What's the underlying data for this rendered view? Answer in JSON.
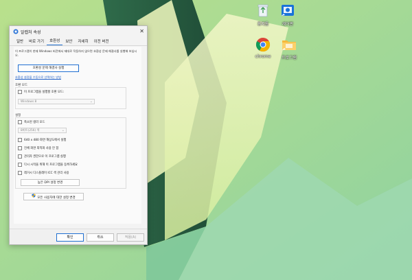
{
  "desktop": {
    "icons": [
      {
        "name": "recycle-bin",
        "label": "휴지통"
      },
      {
        "name": "control-panel",
        "label": "제어판"
      },
      {
        "name": "chrome",
        "label": "chrome"
      },
      {
        "name": "program-folder",
        "label": "프로그램"
      }
    ]
  },
  "dialog": {
    "title": "알캡처 속성",
    "tabs": [
      "일반",
      "바로 가기",
      "호환성",
      "보안",
      "자세히",
      "이전 버전"
    ],
    "active_tab": "호환성",
    "description": "이 프로그램이 현재 Windows 버전에서 제대로 작동하지 않으면 호환성 문제 해결사를 실행해 보십시오.",
    "troubleshooter_button": "호환성 문제 해결사 실행",
    "manual_link": "호환성 설정을 수동으로 선택하는 방법",
    "compat_mode": {
      "title": "호환 모드",
      "checkbox": "이 프로그램을 실행할 호환 모드:",
      "select_value": "Windows 8"
    },
    "settings": {
      "title": "설정",
      "reduced_color": "축소된 컬러 모드",
      "color_select": "8비트(256) 색",
      "res_640": "640 x 480 화면 해상도에서 실행",
      "disable_fullscreen": "전체 화면 최적화 사용 안 함",
      "run_as_admin": "관리자 권한으로 이 프로그램 실행",
      "register_restart": "다시 시작을 위해 이 프로그램을 등록하세요",
      "legacy_icc": "레거시 디스플레이 ICC 색 관리 사용",
      "dpi_button": "높은 DPI 설정 변경"
    },
    "all_users_button": "모든 사용자에 대한 설정 변경",
    "footer": {
      "ok": "확인",
      "cancel": "취소",
      "apply": "적용(A)"
    }
  }
}
